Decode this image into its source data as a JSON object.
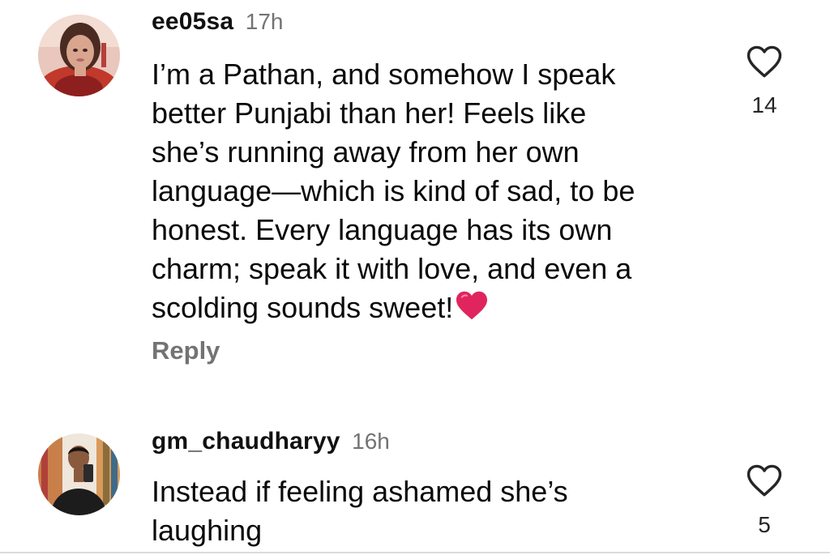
{
  "comments": [
    {
      "username": "ee05sa",
      "time": "17h",
      "lines": [
        "I’m a Pathan, and somehow I speak",
        "better Punjabi than her! Feels like",
        "she’s running away from her own",
        "language—which is kind of sad, to be",
        "honest. Every language has its own",
        "charm; speak it with love, and even a",
        "scolding sounds sweet!"
      ],
      "emoji": "red-heart",
      "reply_label": "Reply",
      "likes": "14",
      "like_icon": "heart-outline-icon"
    },
    {
      "username": "gm_chaudharyy",
      "time": "16h",
      "lines": [
        "Instead if feeling ashamed she’s",
        "laughing"
      ],
      "likes": "5",
      "like_icon": "heart-outline-icon"
    }
  ],
  "colors": {
    "text": "#0a0a0a",
    "secondary": "#737373",
    "heart_emoji": "#e0245e"
  }
}
